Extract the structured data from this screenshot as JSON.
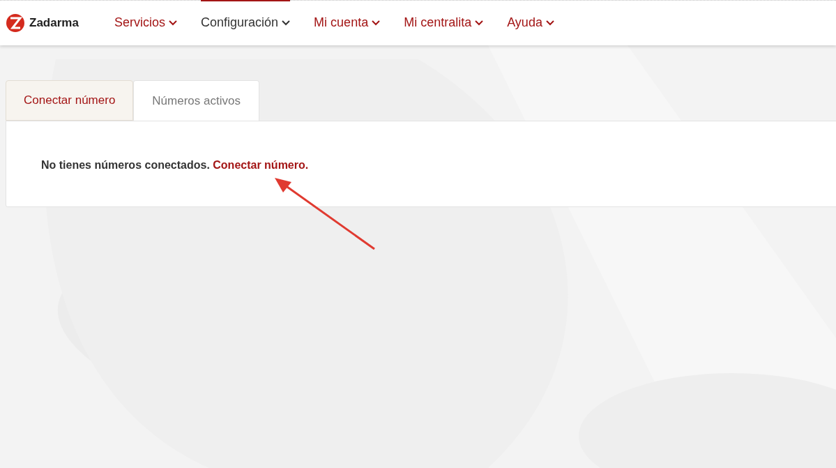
{
  "brand": {
    "name": "Zadarma"
  },
  "nav": [
    {
      "label": "Servicios",
      "selected": false
    },
    {
      "label": "Configuración",
      "selected": true
    },
    {
      "label": "Mi cuenta",
      "selected": false
    },
    {
      "label": "Mi centralita",
      "selected": false
    },
    {
      "label": "Ayuda",
      "selected": false
    }
  ],
  "tabs": [
    {
      "label": "Conectar número",
      "selected": false
    },
    {
      "label": "Números activos",
      "selected": true
    }
  ],
  "message": {
    "text": "No tienes números conectados.",
    "link": "Conectar número."
  }
}
